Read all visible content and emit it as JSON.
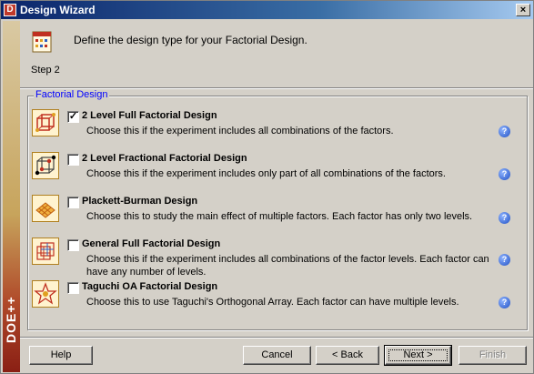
{
  "window": {
    "app_icon": "D",
    "title": "Design Wizard",
    "close_glyph": "×"
  },
  "brand": {
    "text": "DOE++"
  },
  "header": {
    "step_label": "Step 2",
    "instruction": "Define the design type for your Factorial Design."
  },
  "group": {
    "title": "Factorial Design"
  },
  "options": [
    {
      "title": "2 Level Full Factorial Design",
      "description": "Choose this if the experiment includes all combinations of the factors.",
      "checked": true,
      "check_glyph": "✓",
      "icon": "full-factorial-cube-icon"
    },
    {
      "title": "2 Level Fractional Factorial Design",
      "description": "Choose this if the experiment includes only part of all combinations of the factors.",
      "checked": false,
      "check_glyph": "",
      "icon": "fractional-factorial-cube-icon"
    },
    {
      "title": "Plackett-Burman Design",
      "description": "Choose this to study the main effect of multiple factors. Each factor has only two levels.",
      "checked": false,
      "check_glyph": "",
      "icon": "plackett-burman-grid-icon"
    },
    {
      "title": "General Full Factorial Design",
      "description": "Choose this if the experiment includes all combinations of the factor levels. Each factor can have any number of levels.",
      "checked": false,
      "check_glyph": "",
      "icon": "general-factorial-grid-icon"
    },
    {
      "title": "Taguchi OA Factorial Design",
      "description": "Choose this to use Taguchi's Orthogonal Array. Each factor can have multiple levels.",
      "checked": false,
      "check_glyph": "",
      "icon": "taguchi-star-icon"
    }
  ],
  "help_glyph": "?",
  "buttons": {
    "help": "Help",
    "cancel": "Cancel",
    "back": "< Back",
    "next": "Next >",
    "finish": "Finish"
  }
}
